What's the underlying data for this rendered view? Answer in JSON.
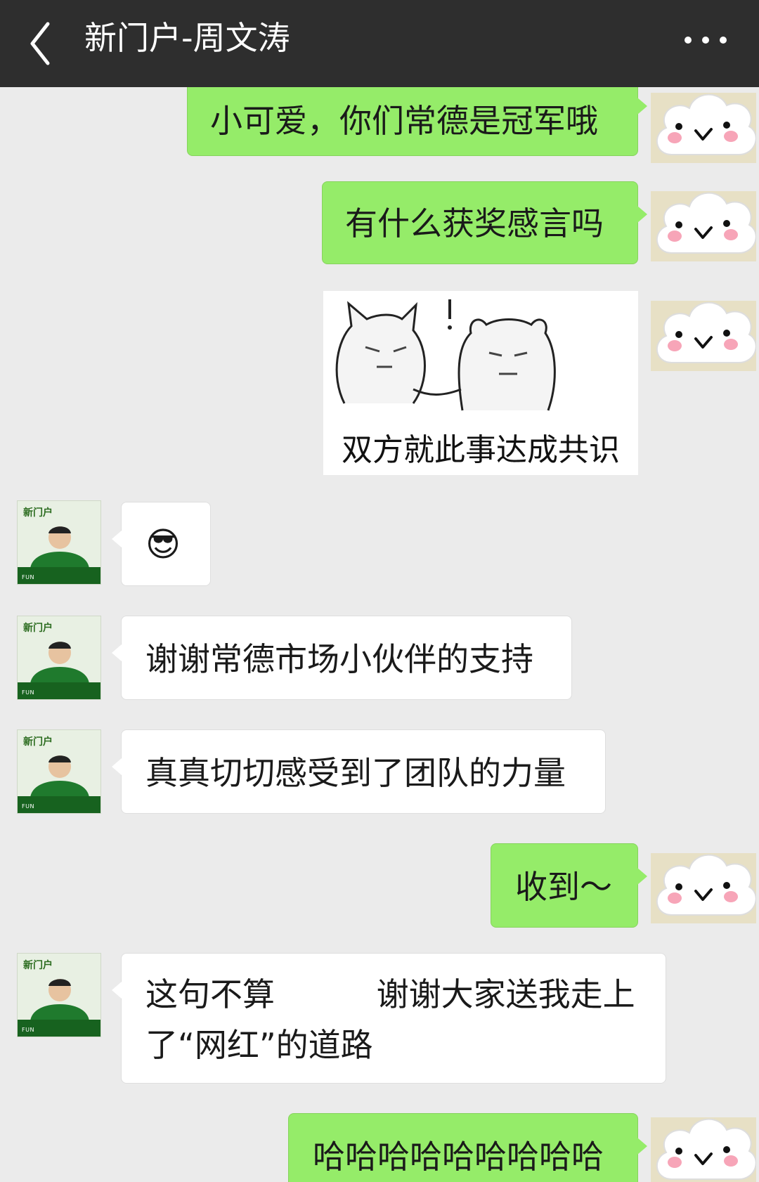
{
  "header": {
    "title": "新门户-周文涛",
    "back_icon": "chevron-left-icon",
    "more_icon": "more-dots-icon"
  },
  "friend_avatar": {
    "logo_text": "新门户",
    "band_text": "FUN"
  },
  "messages": [
    {
      "side": "out",
      "text": "小可爱，你们常德是冠军哦"
    },
    {
      "side": "out",
      "text": "有什么获奖感言吗"
    },
    {
      "side": "out",
      "type": "image",
      "caption": "双方就此事达成共识"
    },
    {
      "side": "in",
      "type": "emoji",
      "emoji": "😎"
    },
    {
      "side": "in",
      "text": "谢谢常德市场小伙伴的支持"
    },
    {
      "side": "in",
      "text": "真真切切感受到了团队的力量"
    },
    {
      "side": "out",
      "text": "收到～"
    },
    {
      "side": "in",
      "line1": "这句不算",
      "line1b": "谢谢大家送我走上",
      "line2": "了“网红”的道路"
    },
    {
      "side": "out",
      "text": "哈哈哈哈哈哈哈哈哈"
    }
  ],
  "colors": {
    "header_bg": "#2e2e2e",
    "chat_bg": "#ebebeb",
    "outgoing_bubble": "#95ec69",
    "incoming_bubble": "#ffffff"
  }
}
